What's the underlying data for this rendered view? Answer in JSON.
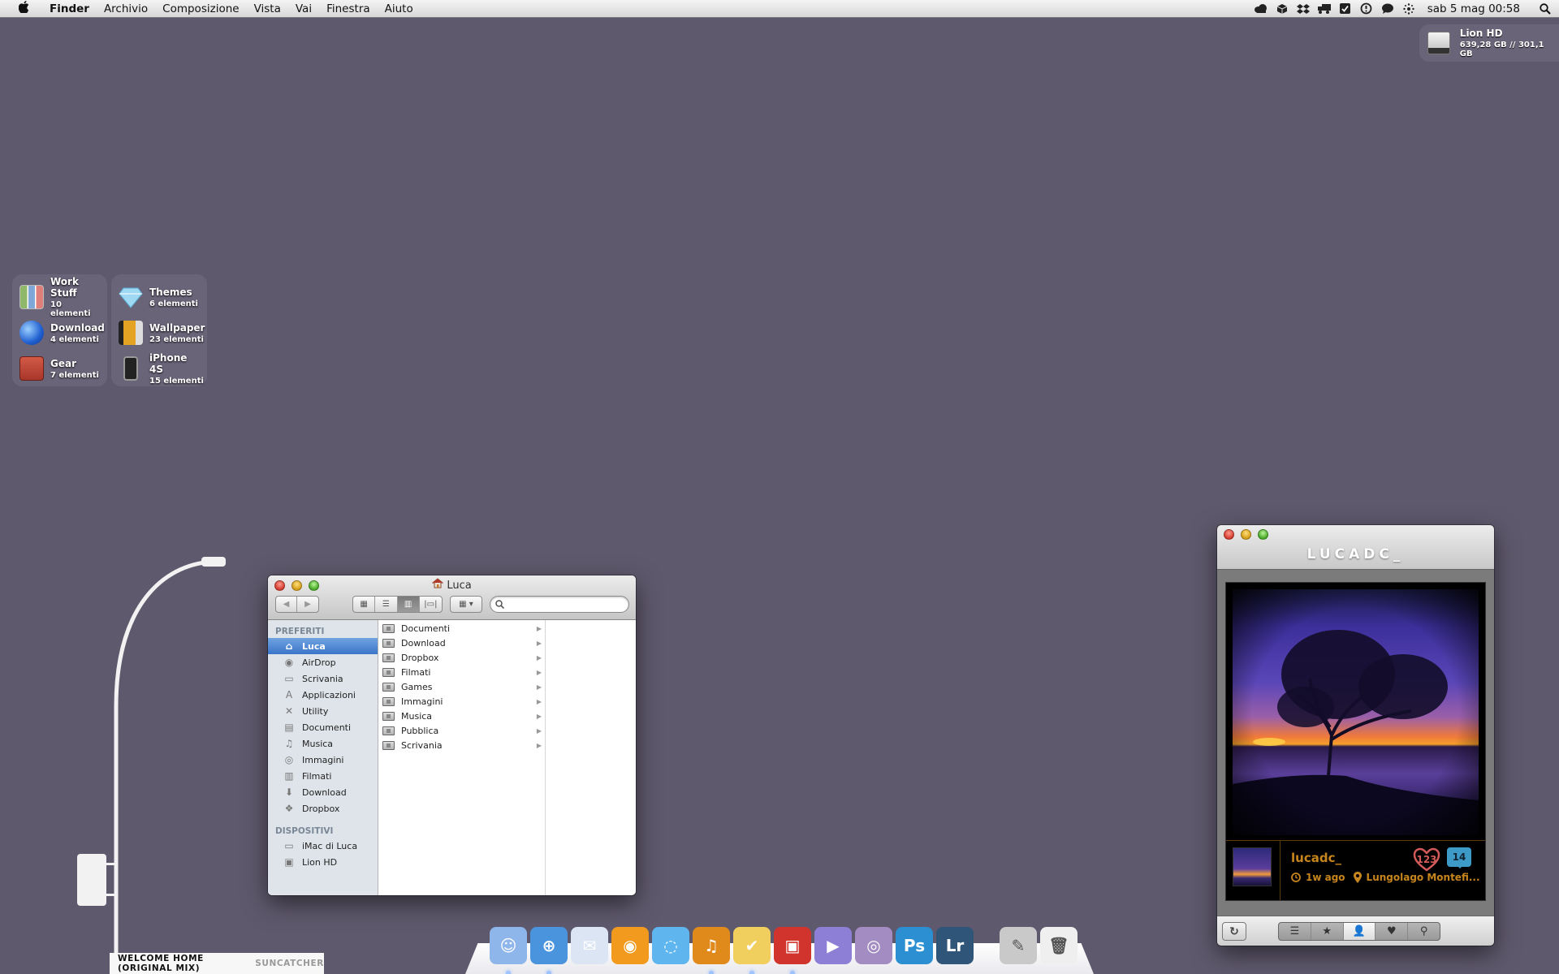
{
  "menubar": {
    "apple_icon": "apple-icon",
    "app_name": "Finder",
    "menus": [
      "Archivio",
      "Composizione",
      "Vista",
      "Vai",
      "Finestra",
      "Aiuto"
    ],
    "tray_icons": [
      "cloud-icon",
      "box-icon",
      "dropbox-icon",
      "truck-icon",
      "checkbox-icon",
      "time-machine-icon",
      "chat-bubble-icon",
      "bluetooth-icon"
    ],
    "clock": "sab 5 mag  00:58",
    "spotlight_icon": "search-icon"
  },
  "drive_widget": {
    "name": "Lion HD",
    "usage": "639,28 GB // 301,1 GB"
  },
  "stacks": [
    {
      "name": "Work Stuff",
      "count": "10 elementi",
      "color": "#8fb86b"
    },
    {
      "name": "Download",
      "count": "4 elementi",
      "color": "#2f6fd6"
    },
    {
      "name": "Gear",
      "count": "7 elementi",
      "color": "#c9473a"
    },
    {
      "name": "Themes",
      "count": "6 elementi",
      "color": "#9fd8f2"
    },
    {
      "name": "Wallpaper",
      "count": "23 elementi",
      "color": "#e5a324"
    },
    {
      "name": "iPhone 4S",
      "count": "15 elementi",
      "color": "#333333"
    }
  ],
  "now_playing": {
    "track": "WELCOME HOME (ORIGINAL MIX)",
    "artist": "SUNCATCHER"
  },
  "finder": {
    "title": "Luca",
    "toolbar": {
      "back": "◀",
      "forward": "▶",
      "view_icons": "▦",
      "view_list": "☰",
      "view_columns": "▥",
      "view_coverflow": "|▭|",
      "arrange": "▦ ▾",
      "search_placeholder": ""
    },
    "sidebar": {
      "favorites_header": "PREFERITI",
      "favorites": [
        {
          "label": "Luca",
          "icon": "⌂",
          "selected": true
        },
        {
          "label": "AirDrop",
          "icon": "◉"
        },
        {
          "label": "Scrivania",
          "icon": "▭"
        },
        {
          "label": "Applicazioni",
          "icon": "A"
        },
        {
          "label": "Utility",
          "icon": "✕"
        },
        {
          "label": "Documenti",
          "icon": "▤"
        },
        {
          "label": "Musica",
          "icon": "♫"
        },
        {
          "label": "Immagini",
          "icon": "◎"
        },
        {
          "label": "Filmati",
          "icon": "▥"
        },
        {
          "label": "Download",
          "icon": "⬇"
        },
        {
          "label": "Dropbox",
          "icon": "❖"
        }
      ],
      "devices_header": "DISPOSITIVI",
      "devices": [
        {
          "label": "iMac di Luca",
          "icon": "▭"
        },
        {
          "label": "Lion HD",
          "icon": "▣"
        }
      ]
    },
    "column_items": [
      "Documenti",
      "Download",
      "Dropbox",
      "Filmati",
      "Games",
      "Immagini",
      "Musica",
      "Pubblica",
      "Scrivania"
    ],
    "disclosure_arrow": "▶"
  },
  "instagram": {
    "brand": "LUCADC_",
    "username": "lucadc_",
    "time": "1w ago",
    "location": "Lungolago Montefi...",
    "likes": "123",
    "comments": "14",
    "refresh_icon": "↻",
    "tabs": [
      {
        "icon": "list-icon",
        "glyph": "☰"
      },
      {
        "icon": "star-icon",
        "glyph": "★"
      },
      {
        "icon": "user-icon",
        "glyph": "👤",
        "active": true
      },
      {
        "icon": "heart-icon",
        "glyph": "♥"
      },
      {
        "icon": "search-icon",
        "glyph": "⚲"
      }
    ]
  },
  "dock": {
    "apps": [
      {
        "name": "Finder",
        "color": "#8fb6ea",
        "glyph": "☺",
        "running": true
      },
      {
        "name": "Safari",
        "color": "#4a94dd",
        "glyph": "⊕",
        "running": true
      },
      {
        "name": "Mail",
        "color": "#dbe5f3",
        "glyph": "✉",
        "running": false
      },
      {
        "name": "RSS Reader",
        "color": "#f29a1e",
        "glyph": "◉",
        "running": false
      },
      {
        "name": "Messages",
        "color": "#5fb5ee",
        "glyph": "◌",
        "running": false
      },
      {
        "name": "iTunes",
        "color": "#e08a1b",
        "glyph": "♫",
        "running": true
      },
      {
        "name": "Things",
        "color": "#f0cf5e",
        "glyph": "✔",
        "running": true
      },
      {
        "name": "Archive",
        "color": "#d0342c",
        "glyph": "▣",
        "running": true
      },
      {
        "name": "Transmit",
        "color": "#8e7fd6",
        "glyph": "▶",
        "running": false
      },
      {
        "name": "Preview",
        "color": "#a38cc2",
        "glyph": "◎",
        "running": false
      },
      {
        "name": "Photoshop",
        "color": "#2b8fd1",
        "glyph": "Ps",
        "running": false
      },
      {
        "name": "Lightroom",
        "color": "#2f5578",
        "glyph": "Lr",
        "running": false
      }
    ],
    "extras": [
      {
        "name": "Applications",
        "color": "#c9c9c9",
        "glyph": "✎"
      },
      {
        "name": "Trash",
        "color": "#efefef",
        "glyph": "🗑"
      }
    ]
  }
}
